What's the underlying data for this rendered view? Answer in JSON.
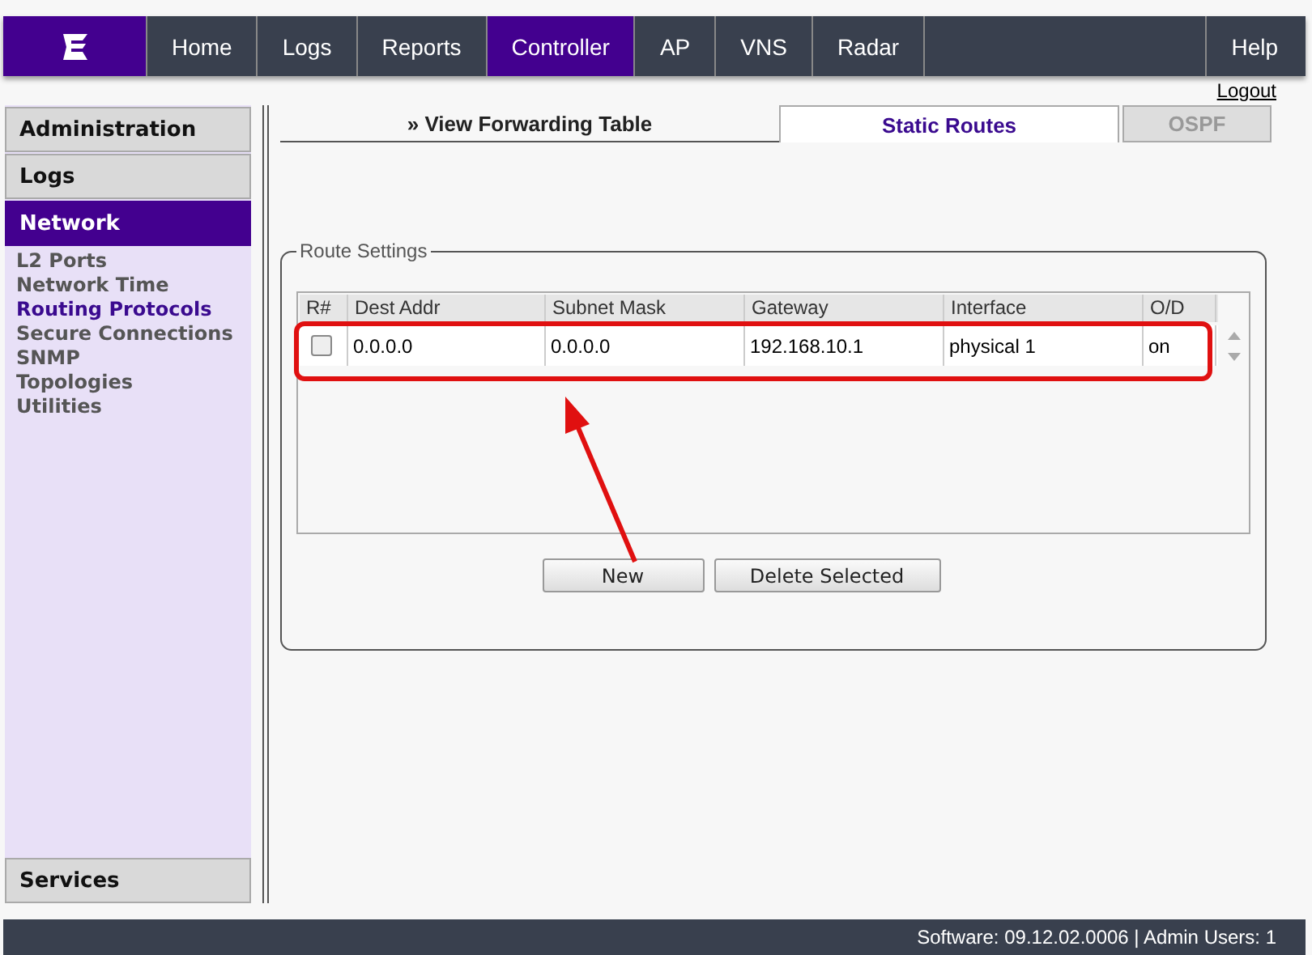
{
  "nav": {
    "items": [
      {
        "label": "Home",
        "selected": false
      },
      {
        "label": "Logs",
        "selected": false
      },
      {
        "label": "Reports",
        "selected": false
      },
      {
        "label": "Controller",
        "selected": true
      },
      {
        "label": "AP",
        "selected": false
      },
      {
        "label": "VNS",
        "selected": false
      },
      {
        "label": "Radar",
        "selected": false
      }
    ],
    "help": "Help"
  },
  "logout": "Logout",
  "sidebar": {
    "sections": [
      {
        "label": "Administration",
        "selected": false
      },
      {
        "label": "Logs",
        "selected": false
      },
      {
        "label": "Network",
        "selected": true,
        "children": [
          {
            "label": "L2 Ports",
            "selected": false
          },
          {
            "label": "Network Time",
            "selected": false
          },
          {
            "label": "Routing Protocols",
            "selected": true
          },
          {
            "label": "Secure Connections",
            "selected": false
          },
          {
            "label": "SNMP",
            "selected": false
          },
          {
            "label": "Topologies",
            "selected": false
          },
          {
            "label": "Utilities",
            "selected": false
          }
        ]
      }
    ],
    "bottom": "Services"
  },
  "tabs": [
    {
      "label": "» View Forwarding Table",
      "kind": "link",
      "selected": false,
      "disabled": false
    },
    {
      "label": "Static Routes",
      "kind": "tab",
      "selected": true,
      "disabled": false
    },
    {
      "label": "OSPF",
      "kind": "tab",
      "selected": false,
      "disabled": true
    }
  ],
  "route_settings": {
    "legend": "Route Settings",
    "columns": [
      "R#",
      "Dest Addr",
      "Subnet Mask",
      "Gateway",
      "Interface",
      "O/D"
    ],
    "rows": [
      {
        "checked": false,
        "cells": [
          "",
          "0.0.0.0",
          "0.0.0.0",
          "192.168.10.1",
          "physical 1",
          "on"
        ]
      }
    ],
    "buttons": [
      "New",
      "Delete Selected"
    ]
  },
  "status_bar": "Software: 09.12.02.0006 | Admin Users: 1"
}
